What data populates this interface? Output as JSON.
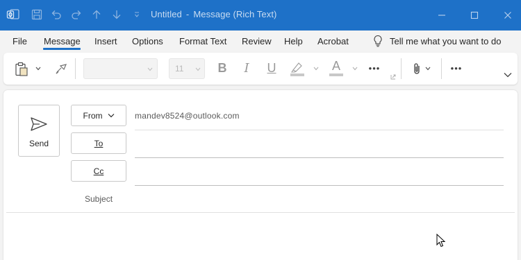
{
  "window": {
    "title_document": "Untitled",
    "title_separator": "-",
    "title_type": "Message (Rich Text)",
    "accent_color": "#1e71c8"
  },
  "titlebar_icons": [
    "outlook-logo-icon",
    "save-icon",
    "undo-icon",
    "redo-icon",
    "up-arrow-icon",
    "down-arrow-icon",
    "customize-qat-icon"
  ],
  "window_controls": [
    "minimize-icon",
    "maximize-icon",
    "close-icon"
  ],
  "menu": {
    "items": [
      "File",
      "Message",
      "Insert",
      "Options",
      "Format Text",
      "Review",
      "Help",
      "Acrobat"
    ],
    "active": "Message",
    "tell_me": "Tell me what you want to do"
  },
  "ribbon": {
    "font_name": "",
    "font_size": "11",
    "bold": "B",
    "italic": "I",
    "underline": "U",
    "font_color_letter": "A",
    "more": "•••"
  },
  "compose": {
    "send_label": "Send",
    "from_label": "From",
    "from_value": "mandev8524@outlook.com",
    "to_label": "To",
    "cc_label": "Cc",
    "subject_label": "Subject",
    "to_value": "",
    "cc_value": "",
    "subject_value": ""
  }
}
